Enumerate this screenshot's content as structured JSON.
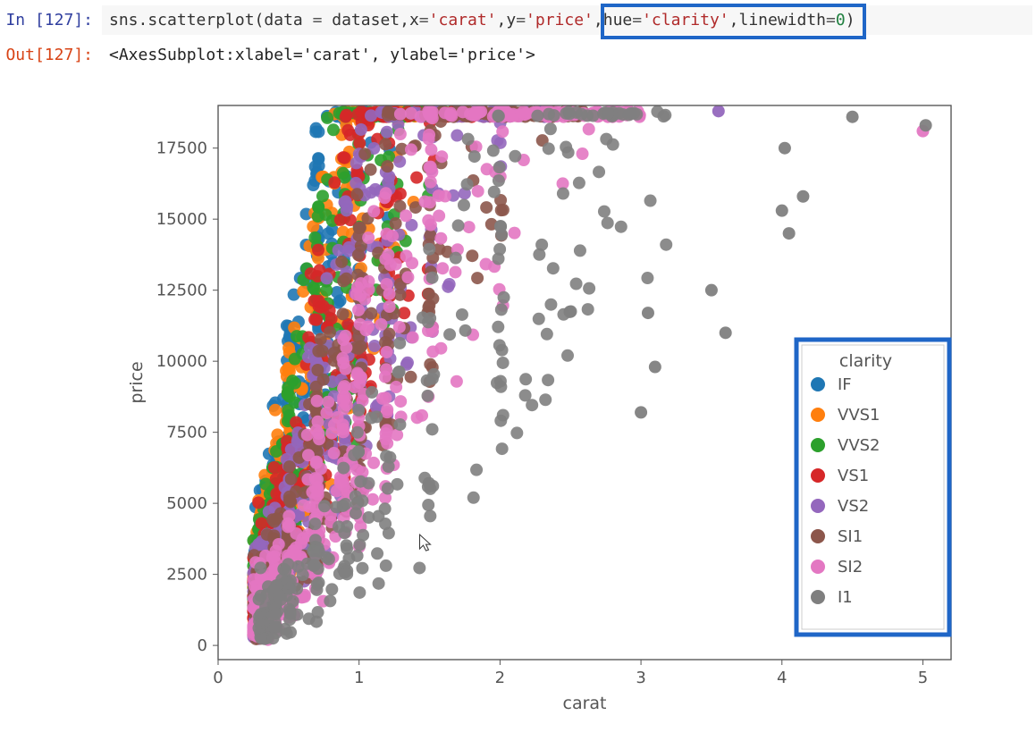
{
  "input": {
    "prompt_prefix": "In [",
    "prompt_num": "127",
    "prompt_suffix": "]:",
    "code_parts": {
      "p1": "sns.scatterplot(data ",
      "eq1": "=",
      "p2": " dataset,x",
      "eq2": "=",
      "s1": "'carat'",
      "p3": ",y",
      "eq3": "=",
      "s2": "'price'",
      "p4": ",hue",
      "eq4": "=",
      "s3": "'clarity'",
      "p5": ",linewidth",
      "eq5": "=",
      "n1": "0",
      "p6": ")"
    }
  },
  "output": {
    "prompt_prefix": "Out[",
    "prompt_num": "127",
    "prompt_suffix": "]:",
    "text": "<AxesSubplot:xlabel='carat', ylabel='price'>"
  },
  "chart_data": {
    "type": "scatter",
    "title": "",
    "xlabel": "carat",
    "ylabel": "price",
    "xlim": [
      0,
      5.2
    ],
    "ylim": [
      -500,
      19000
    ],
    "xticks": [
      0,
      1,
      2,
      3,
      4,
      5
    ],
    "yticks": [
      0,
      2500,
      5000,
      7500,
      10000,
      12500,
      15000,
      17500
    ],
    "legend_title": "clarity",
    "series": [
      {
        "name": "IF",
        "color": "#1f77b4",
        "density": "dense cluster, carat≈0.3–1.2, price up to 18800"
      },
      {
        "name": "VVS1",
        "color": "#ff7f0e",
        "density": "dense cluster, carat≈0.3–1.6, price up to 18800"
      },
      {
        "name": "VVS2",
        "color": "#2ca02c",
        "density": "dense cluster, carat≈0.3–1.7, price up to 18800"
      },
      {
        "name": "VS1",
        "color": "#d62728",
        "density": "dense cluster, carat≈0.3–2.2, price up to 18800"
      },
      {
        "name": "VS2",
        "color": "#9467bd",
        "density": "dense cluster, carat≈0.3–2.5, price up to 18800; outlier ≈3.5"
      },
      {
        "name": "SI1",
        "color": "#8c564b",
        "density": "dense cluster, carat≈0.3–2.7, price up to 18800"
      },
      {
        "name": "SI2",
        "color": "#e377c2",
        "density": "dense cluster, carat≈0.3–3.0, price up to 18800; outlier ≈5.0"
      },
      {
        "name": "I1",
        "color": "#7f7f7f",
        "density": "spread, carat≈0.3–5.0, lower price curve, many large-carat outliers"
      }
    ],
    "note": "Large overplotted scatter of diamonds dataset; points overlap heavily in carat 0.2–2.0 band forming a fan shape. Exact point coordinates not individually readable; rendered procedurally to match visual density."
  }
}
